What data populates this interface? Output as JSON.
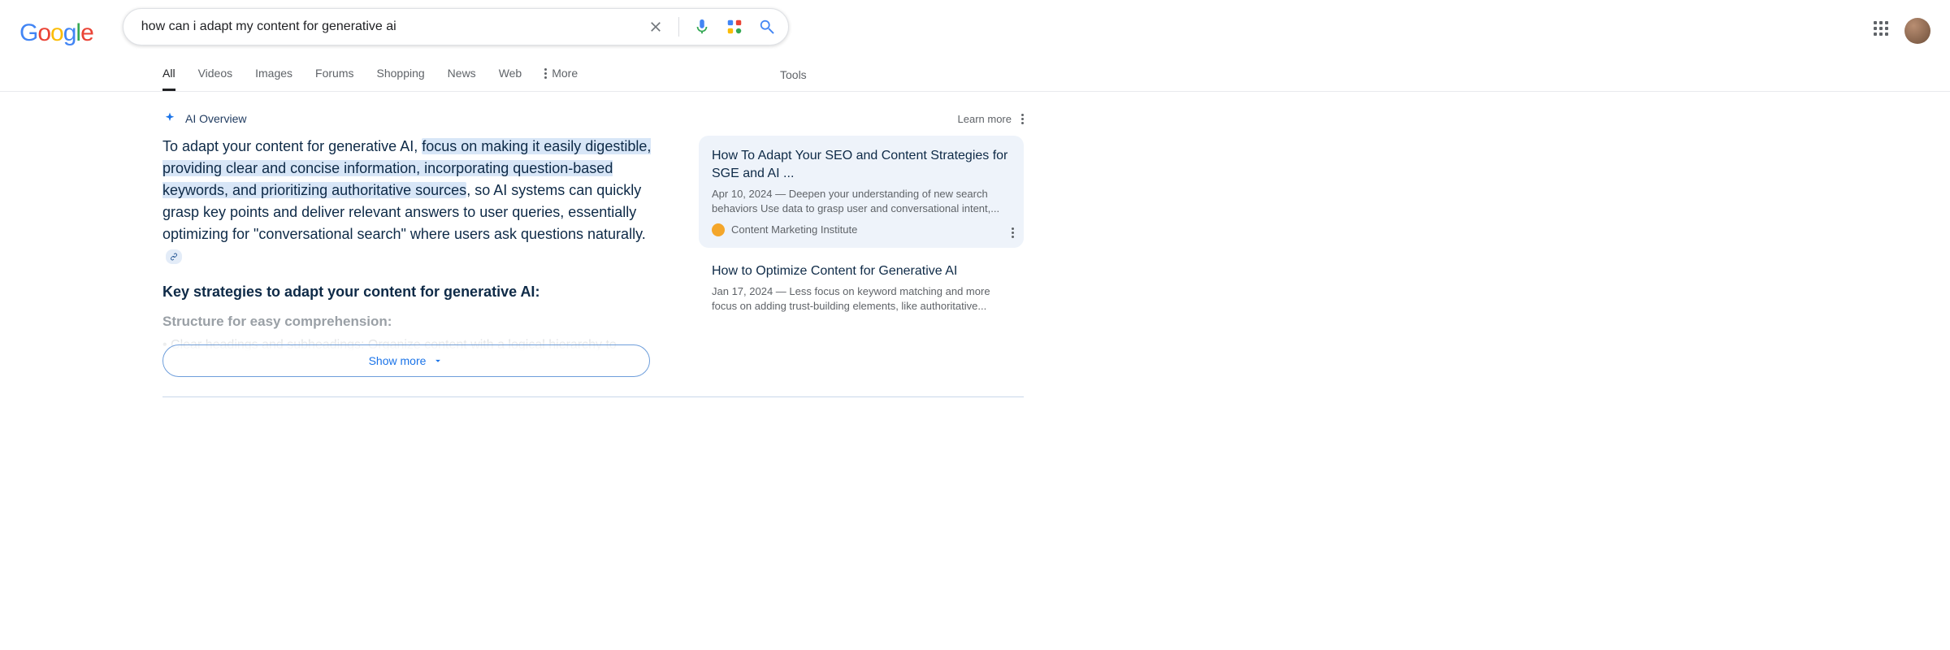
{
  "header": {
    "logo": "Google",
    "search_value": "how can i adapt my content for generative ai"
  },
  "tabs": {
    "items": [
      "All",
      "Videos",
      "Images",
      "Forums",
      "Shopping",
      "News",
      "Web"
    ],
    "active": "All",
    "more": "More",
    "tools": "Tools"
  },
  "ai": {
    "label": "AI Overview",
    "learn_more": "Learn more",
    "text_lead": "To adapt your content for generative AI, ",
    "text_highlight": "focus on making it easily digestible, providing clear and concise information, incorporating question-based keywords, and prioritizing authoritative sources",
    "text_tail": ", so AI systems can quickly grasp key points and deliver relevant answers to user queries, essentially optimizing for \"conversational search\" where users ask questions naturally.",
    "subhead": "Key strategies to adapt your content for generative AI:",
    "fade_sub": "Structure for easy comprehension:",
    "fade_line": "• Clear headings and subheadings: Organize content with a logical hierarchy to",
    "show_more": "Show more"
  },
  "cards": [
    {
      "title": "How To Adapt Your SEO and Content Strategies for SGE and AI ...",
      "date": "Apr 10, 2024",
      "snippet": "Deepen your understanding of new search behaviors Use data to grasp user and conversational intent,...",
      "source": "Content Marketing Institute"
    },
    {
      "title": "How to Optimize Content for Generative AI",
      "date": "Jan 17, 2024",
      "snippet": "Less focus on keyword matching and more focus on adding trust-building elements, like authoritative...",
      "source": ""
    }
  ]
}
